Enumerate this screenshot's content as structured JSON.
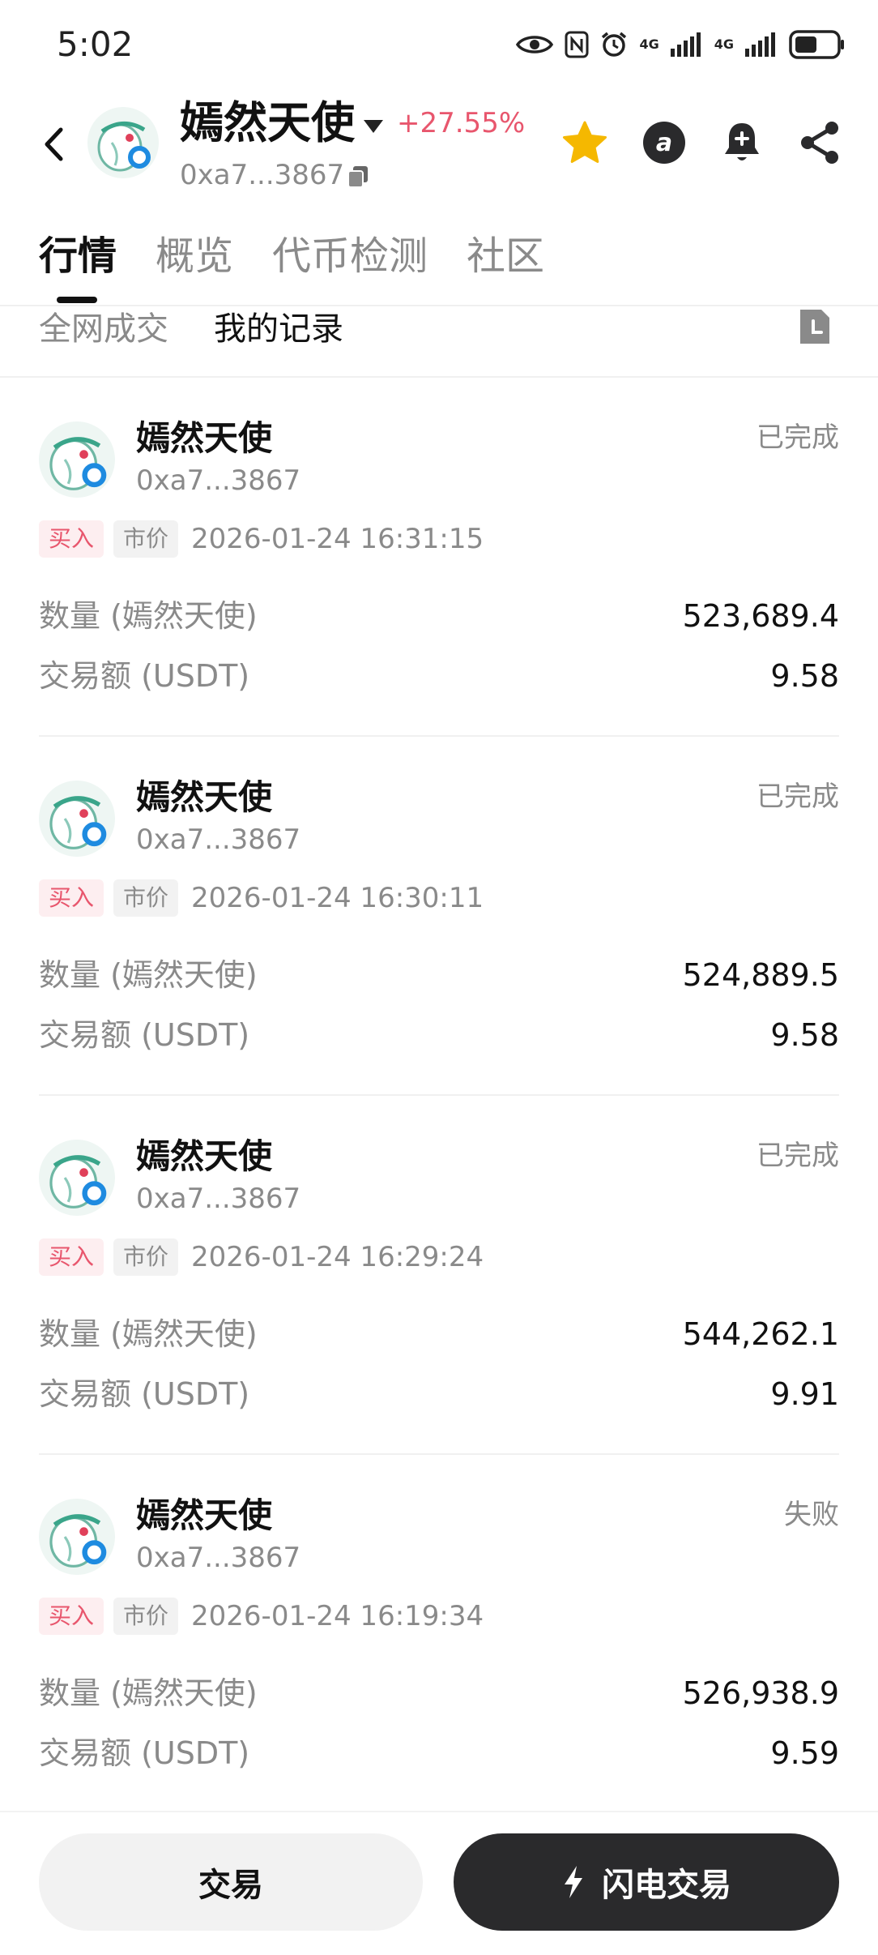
{
  "status_bar": {
    "time": "5:02",
    "icons": [
      "eye-icon",
      "nfc-icon",
      "alarm-icon",
      "signal-4g-icon",
      "signal-4g-icon",
      "battery-icon"
    ],
    "network_label_1": "4G",
    "network_label_2": "4G"
  },
  "header": {
    "token_name": "嫣然天使",
    "price_change": "+27.55%",
    "price_change_color": "#e8566d",
    "address": "0xa7...3867",
    "star_color": "#f5b800",
    "icons": [
      "back-icon",
      "copy-icon",
      "star-icon",
      "at-icon",
      "add-alert-icon",
      "share-icon"
    ]
  },
  "tabs": [
    {
      "label": "行情",
      "active": true
    },
    {
      "label": "概览",
      "active": false
    },
    {
      "label": "代币检测",
      "active": false
    },
    {
      "label": "社区",
      "active": false
    }
  ],
  "subtabs": [
    {
      "label": "全网成交",
      "active": false
    },
    {
      "label": "我的记录",
      "active": true
    }
  ],
  "trades": [
    {
      "name": "嫣然天使",
      "address": "0xa7...3867",
      "status": "已完成",
      "side": "买入",
      "order_type": "市价",
      "time": "2026-01-24 16:31:15",
      "quantity_label": "数量 (嫣然天使)",
      "quantity": "523,689.4",
      "amount_label": "交易额 (USDT)",
      "amount": "9.58"
    },
    {
      "name": "嫣然天使",
      "address": "0xa7...3867",
      "status": "已完成",
      "side": "买入",
      "order_type": "市价",
      "time": "2026-01-24 16:30:11",
      "quantity_label": "数量 (嫣然天使)",
      "quantity": "524,889.5",
      "amount_label": "交易额 (USDT)",
      "amount": "9.58"
    },
    {
      "name": "嫣然天使",
      "address": "0xa7...3867",
      "status": "已完成",
      "side": "买入",
      "order_type": "市价",
      "time": "2026-01-24 16:29:24",
      "quantity_label": "数量 (嫣然天使)",
      "quantity": "544,262.1",
      "amount_label": "交易额 (USDT)",
      "amount": "9.91"
    },
    {
      "name": "嫣然天使",
      "address": "0xa7...3867",
      "status": "失败",
      "side": "买入",
      "order_type": "市价",
      "time": "2026-01-24 16:19:34",
      "quantity_label": "数量 (嫣然天使)",
      "quantity": "526,938.9",
      "amount_label": "交易额 (USDT)",
      "amount": "9.59"
    }
  ],
  "bottom_bar": {
    "trade_label": "交易",
    "flash_trade_label": "闪电交易",
    "flash_icon": "lightning-icon"
  }
}
